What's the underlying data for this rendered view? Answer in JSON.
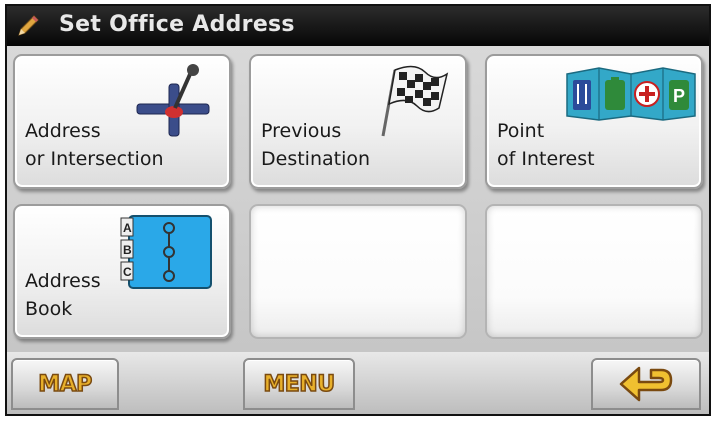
{
  "header": {
    "title": "Set Office Address",
    "icon": "pencil-icon"
  },
  "tiles": [
    {
      "lines": [
        "Address",
        "or Intersection"
      ],
      "icon": "pushpin-crosshair-icon"
    },
    {
      "lines": [
        "Previous",
        "Destination"
      ],
      "icon": "checkered-flag-icon"
    },
    {
      "lines": [
        "Point",
        "of Interest"
      ],
      "icon": "poi-map-icon"
    },
    {
      "lines": [
        "Address",
        "Book"
      ],
      "icon": "address-book-icon"
    },
    {
      "lines": [],
      "empty": true
    },
    {
      "lines": [],
      "empty": true
    }
  ],
  "bottom_bar": {
    "map_label": "MAP",
    "menu_label": "MENU",
    "back_icon": "back-arrow-icon"
  },
  "colors": {
    "title_bar": "#0c0c0c",
    "button_text": "#e8b02a",
    "book_blue": "#2aa8e8"
  }
}
